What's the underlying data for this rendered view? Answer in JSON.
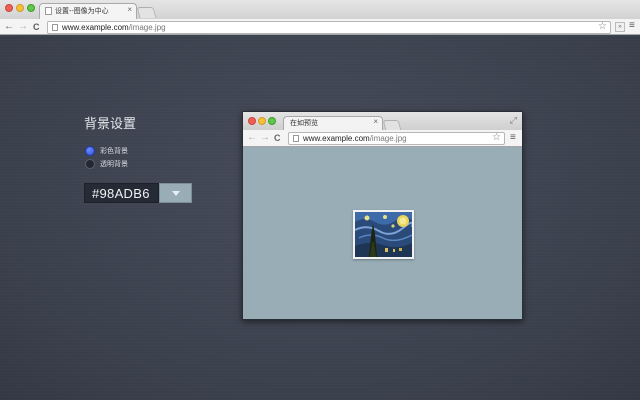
{
  "window": {
    "tab_title": "设置--图像为中心",
    "tab_close": "×",
    "url_host": "www.example.com",
    "url_path": "/image.jpg"
  },
  "settings": {
    "title": "背景设置",
    "options": [
      {
        "label": "彩色背景",
        "selected": true
      },
      {
        "label": "透明背景",
        "selected": false
      }
    ],
    "color_value": "#98ADB6",
    "accent_color": "#98adb6"
  },
  "preview": {
    "tab_title": "在如预览",
    "tab_close": "×",
    "url_host": "www.example.com",
    "url_path": "/image.jpg",
    "background_color": "#98adb6",
    "image_icon": "starry-night-image"
  },
  "icons": {
    "back": "←",
    "forward": "→",
    "reload": "C",
    "star": "☆",
    "menu": "≡",
    "resize": "⤢"
  }
}
